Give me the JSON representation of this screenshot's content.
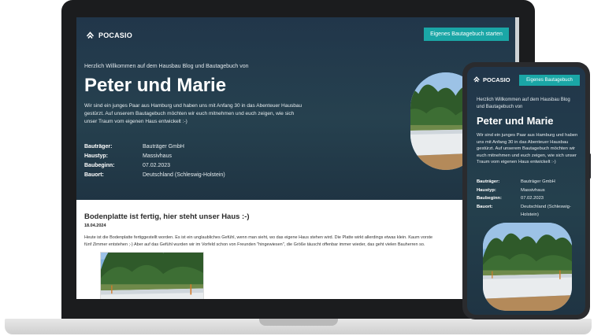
{
  "brand": {
    "name": "POCASIO"
  },
  "cta": {
    "desktop_label": "Eigenes Bautagebuch starten",
    "mobile_label": "Eigenes Bautagebuch"
  },
  "hero": {
    "welcome": "Herzlich Willkommen auf dem Hausbau Blog und Bautagebuch von",
    "names": "Peter und Marie",
    "intro": "Wir sind ein junges Paar aus Hamburg und haben uns mit Anfang 30 in das Abenteuer Hausbau gestürzt. Auf unserem Bautagebuch möchten wir euch mitnehmen und euch zeigen, wie sich unser Traum vom eigenen Haus entwickelt :-)",
    "facts": [
      {
        "label": "Bauträger:",
        "value": "Bauträger GmbH"
      },
      {
        "label": "Haustyp:",
        "value": "Massivhaus"
      },
      {
        "label": "Baubeginn:",
        "value": "07.02.2023"
      },
      {
        "label": "Bauort:",
        "value": "Deutschland (Schleswig-Holstein)"
      }
    ]
  },
  "post": {
    "title": "Bodenplatte ist fertig, hier steht unser Haus :-)",
    "date": "18.04.2024",
    "text_line1": "Heute ist die Bodenplatte fertiggestellt worden. Es ist ein unglaubliches Gefühl, wenn man sieht, wo das eigene Haus stehen wird. Die Platte wirkt allerdings etwas klein. Kaum vorste",
    "text_line2": "fünf Zimmer entstehen ;-) Aber auf das Gefühl wurden wir im Vorfeld schon von Freunden \"hingewiesen\", die Größe täuscht offenbar immer wieder, das geht vielen Bauherren so."
  },
  "icons": {
    "logo": "pocasio-logo-icon",
    "photo": "construction-site-photo"
  },
  "colors": {
    "hero_bg": "#21364a",
    "accent": "#1aa6a6",
    "device_frame": "#1b1c1e"
  }
}
